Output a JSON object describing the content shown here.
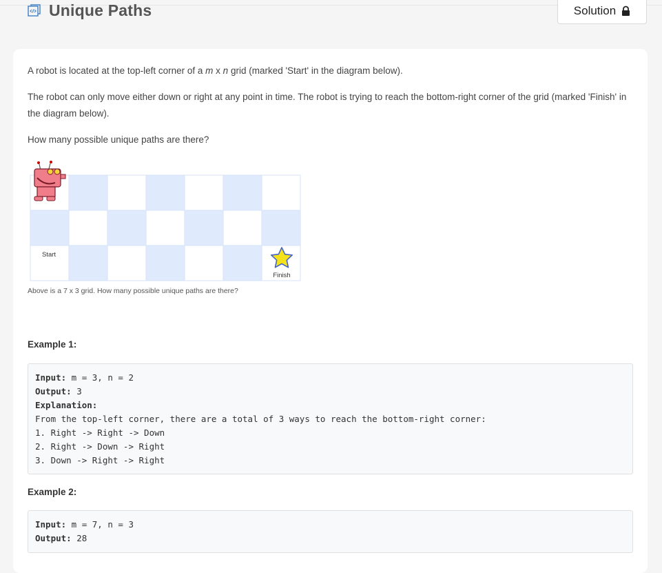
{
  "header": {
    "title": "Unique Paths",
    "solution_label": "Solution"
  },
  "description": {
    "p1_pre": "A robot is located at the top-left corner of a ",
    "p1_m": "m",
    "p1_x": " x ",
    "p1_n": "n",
    "p1_post": " grid (marked 'Start' in the diagram below).",
    "p2": "The robot can only move either down or right at any point in time. The robot is trying to reach the bottom-right corner of the grid (marked 'Finish' in the diagram below).",
    "p3": "How many possible unique paths are there?",
    "grid_start": "Start",
    "grid_finish": "Finish",
    "caption": "Above is a 7 x 3 grid. How many possible unique paths are there?"
  },
  "examples": [
    {
      "label": "Example 1:",
      "input_key": "Input:",
      "input_val": " m = 3, n = 2",
      "output_key": "Output:",
      "output_val": " 3",
      "explanation_key": "Explanation:",
      "lines": [
        "From the top-left corner, there are a total of 3 ways to reach the bottom-right corner:",
        "1. Right -> Right -> Down",
        "2. Right -> Down -> Right",
        "3. Down -> Right -> Right"
      ]
    },
    {
      "label": "Example 2:",
      "input_key": "Input:",
      "input_val": " m = 7, n = 3",
      "output_key": "Output:",
      "output_val": " 28"
    }
  ],
  "colors": {
    "cell_blue": "#dfeafd",
    "cell_white": "#ffffff",
    "cell_border": "#d7e3f8",
    "icon_blue": "#4a86c8"
  }
}
